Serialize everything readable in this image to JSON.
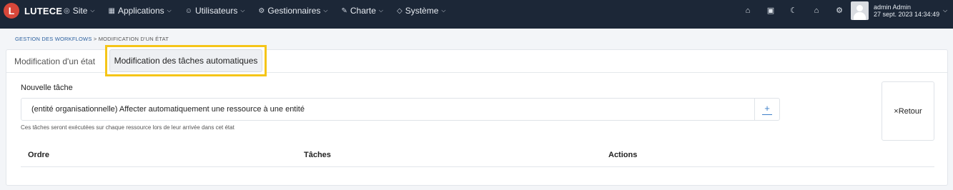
{
  "app": {
    "logo_letter": "L",
    "brand": "LUTECE"
  },
  "menu": [
    {
      "icon": "globe-icon",
      "glyph": "◎",
      "label": "Site"
    },
    {
      "icon": "grid-icon",
      "glyph": "▦",
      "label": "Applications"
    },
    {
      "icon": "users-icon",
      "glyph": "☺",
      "label": "Utilisateurs"
    },
    {
      "icon": "user-cog-icon",
      "glyph": "⚙",
      "label": "Gestionnaires"
    },
    {
      "icon": "brush-icon",
      "glyph": "✎",
      "label": "Charte"
    },
    {
      "icon": "shield-icon",
      "glyph": "◇",
      "label": "Système"
    }
  ],
  "nav_icons": [
    {
      "name": "home-icon",
      "glyph": "⌂"
    },
    {
      "name": "layout-icon",
      "glyph": "▣"
    },
    {
      "name": "moon-icon",
      "glyph": "☾"
    },
    {
      "name": "home-alt-icon",
      "glyph": "⌂"
    },
    {
      "name": "settings-icon",
      "glyph": "⚙"
    }
  ],
  "user": {
    "name": "admin Admin",
    "datetime": "27 sept. 2023 14:34:49"
  },
  "breadcrumb": {
    "parent": "GESTION DES WORKFLOWS",
    "separator": " > ",
    "current": "MODIFICATION D'UN ÉTAT"
  },
  "tabs": {
    "state": "Modification d'un état",
    "tasks": "Modification des tâches automatiques"
  },
  "form": {
    "new_task_label": "Nouvelle tâche",
    "task_select_value": "(entité organisationnelle) Affecter automatiquement une ressource à une entité",
    "add_glyph": "+",
    "help_text": "Ces tâches seront exécutées sur chaque ressource lors de leur arrivée dans cet état"
  },
  "back_button": {
    "label": "×Retour"
  },
  "table": {
    "headers": [
      "Ordre",
      "Tâches",
      "Actions"
    ]
  },
  "colors": {
    "navbar": "#1c2737",
    "logo": "#d8473a",
    "highlight": "#f5c518",
    "accent": "#3d7fc9"
  }
}
